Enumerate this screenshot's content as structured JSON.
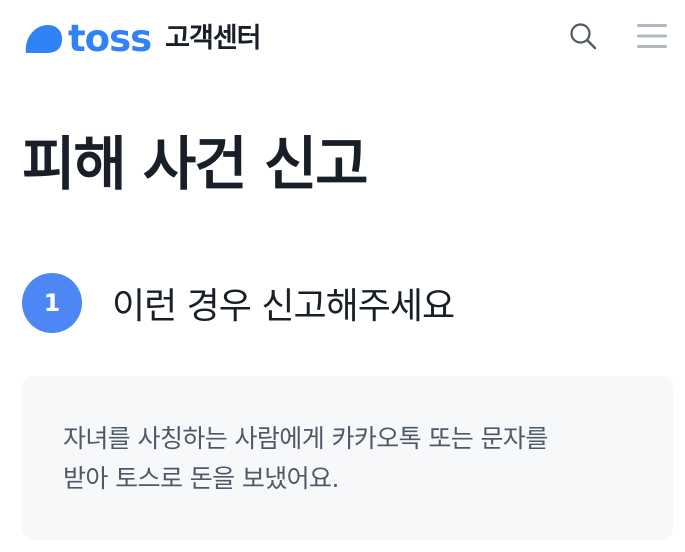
{
  "header": {
    "logo_text": "toss",
    "service_label": "고객센터",
    "search_icon": "search-icon",
    "menu_icon": "hamburger-menu-icon",
    "brand_color": "#3182f6"
  },
  "main": {
    "title": "피해 사건 신고",
    "step": {
      "number": "1",
      "title": "이런 경우 신고해주세요"
    },
    "card": {
      "text": "자녀를 사칭하는 사람에게 카카오톡 또는 문자를\n받아 토스로 돈을 보냈어요."
    }
  }
}
